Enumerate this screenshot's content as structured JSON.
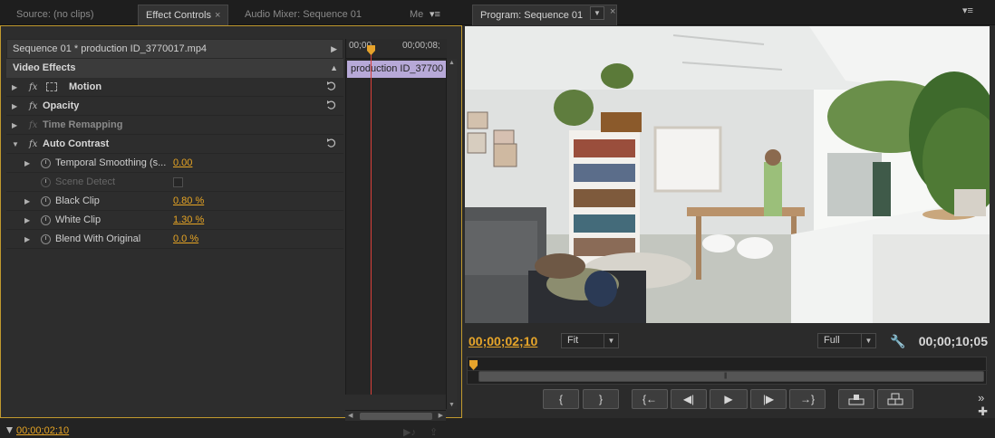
{
  "tabs_left": [
    {
      "label": "Source: (no clips)"
    },
    {
      "label": "Effect Controls"
    },
    {
      "label": "Audio Mixer: Sequence 01"
    },
    {
      "label": "Me"
    }
  ],
  "tabs_right": [
    {
      "label": "Program: Sequence 01"
    }
  ],
  "effect_controls": {
    "sequence_label": "Sequence 01 * production ID_3770017.mp4",
    "section_title": "Video Effects",
    "effects": [
      {
        "label": "Motion",
        "enabled": true
      },
      {
        "label": "Opacity",
        "enabled": true
      },
      {
        "label": "Time Remapping",
        "enabled": false
      },
      {
        "label": "Auto Contrast",
        "enabled": true
      }
    ],
    "properties": [
      {
        "label": "Temporal Smoothing (s...",
        "value": "0.00",
        "enabled": true
      },
      {
        "label": "Scene Detect",
        "value": "",
        "enabled": false
      },
      {
        "label": "Black Clip",
        "value": "0.80 %",
        "enabled": true
      },
      {
        "label": "White Clip",
        "value": "1.30 %",
        "enabled": true
      },
      {
        "label": "Blend With Original",
        "value": "0.0 %",
        "enabled": true
      }
    ],
    "timeline": {
      "ruler_start": "00;00",
      "ruler_end": "00;00;08;",
      "clip_label": "production ID_37700"
    },
    "current_time": "00;00;02;10"
  },
  "program": {
    "current_time": "00;00;02;10",
    "duration": "00;00;10;05",
    "zoom": "Fit",
    "quality": "Full",
    "transport": [
      "{",
      "}",
      "{←",
      "◀|",
      "▶",
      "|▶",
      "→}",
      "lift",
      "extract"
    ]
  },
  "colors": {
    "accent": "#e6a52a",
    "panel_border": "#c19a2e",
    "clip": "#b7a9d8",
    "playhead": "#d9403a"
  }
}
